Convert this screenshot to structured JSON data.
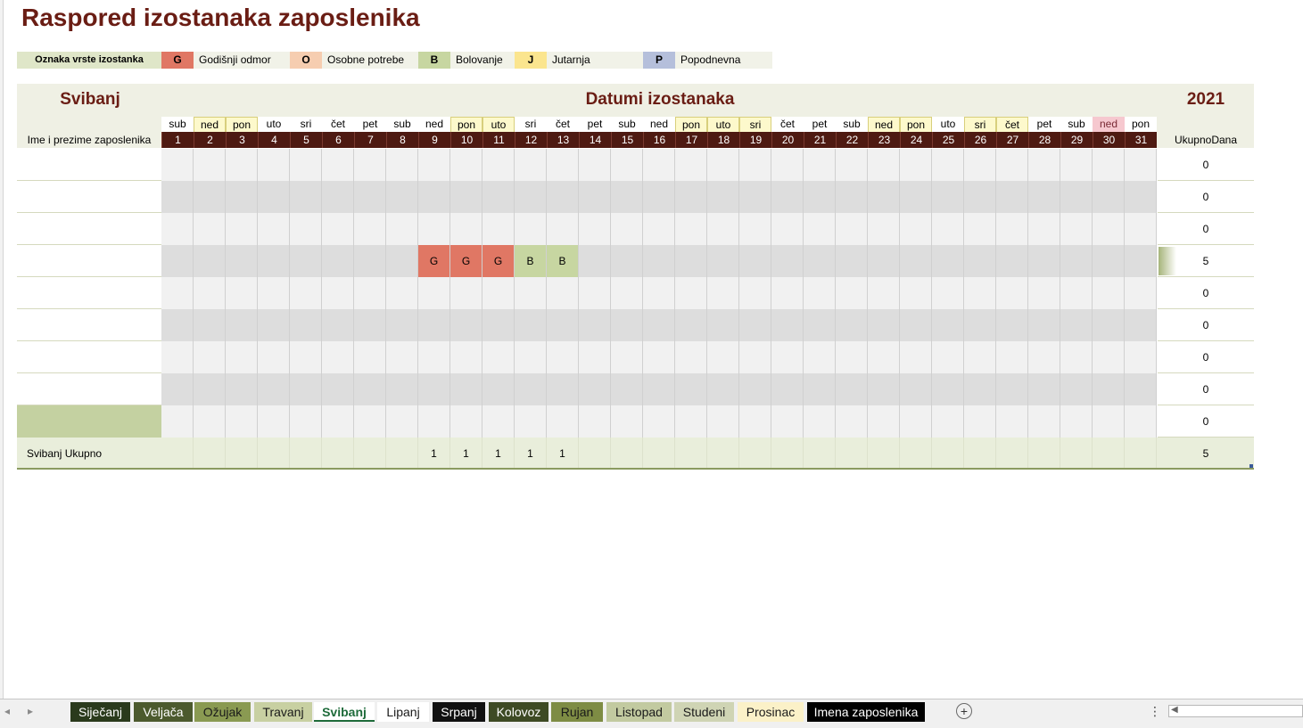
{
  "title": "Raspored izostanaka zaposlenika",
  "legend": {
    "header": "Oznaka vrste izostanka",
    "items": [
      {
        "code": "G",
        "label": "Godišnji odmor",
        "color": "#e07764"
      },
      {
        "code": "O",
        "label": "Osobne potrebe",
        "color": "#f6cdb0"
      },
      {
        "code": "B",
        "label": "Bolovanje",
        "color": "#c7d6a1"
      },
      {
        "code": "J",
        "label": "Jutarnja",
        "color": "#fbe58e"
      },
      {
        "code": "P",
        "label": "Popodnevna",
        "color": "#b5bfdb"
      }
    ]
  },
  "header": {
    "month": "Svibanj",
    "dates_title": "Datumi izostanaka",
    "year": "2021",
    "name_col": "Ime i prezime zaposlenika",
    "total_col": "UkupnoDana"
  },
  "days": [
    {
      "num": "1",
      "dow": "sub",
      "hl": false,
      "hol": false
    },
    {
      "num": "2",
      "dow": "ned",
      "hl": true,
      "hol": false
    },
    {
      "num": "3",
      "dow": "pon",
      "hl": true,
      "hol": false
    },
    {
      "num": "4",
      "dow": "uto",
      "hl": false,
      "hol": false
    },
    {
      "num": "5",
      "dow": "sri",
      "hl": false,
      "hol": false
    },
    {
      "num": "6",
      "dow": "čet",
      "hl": false,
      "hol": false
    },
    {
      "num": "7",
      "dow": "pet",
      "hl": false,
      "hol": false
    },
    {
      "num": "8",
      "dow": "sub",
      "hl": false,
      "hol": false
    },
    {
      "num": "9",
      "dow": "ned",
      "hl": false,
      "hol": false
    },
    {
      "num": "10",
      "dow": "pon",
      "hl": true,
      "hol": false
    },
    {
      "num": "11",
      "dow": "uto",
      "hl": true,
      "hol": false
    },
    {
      "num": "12",
      "dow": "sri",
      "hl": false,
      "hol": false
    },
    {
      "num": "13",
      "dow": "čet",
      "hl": false,
      "hol": false
    },
    {
      "num": "14",
      "dow": "pet",
      "hl": false,
      "hol": false
    },
    {
      "num": "15",
      "dow": "sub",
      "hl": false,
      "hol": false
    },
    {
      "num": "16",
      "dow": "ned",
      "hl": false,
      "hol": false
    },
    {
      "num": "17",
      "dow": "pon",
      "hl": true,
      "hol": false
    },
    {
      "num": "18",
      "dow": "uto",
      "hl": true,
      "hol": false
    },
    {
      "num": "19",
      "dow": "sri",
      "hl": true,
      "hol": false
    },
    {
      "num": "20",
      "dow": "čet",
      "hl": false,
      "hol": false
    },
    {
      "num": "21",
      "dow": "pet",
      "hl": false,
      "hol": false
    },
    {
      "num": "22",
      "dow": "sub",
      "hl": false,
      "hol": false
    },
    {
      "num": "23",
      "dow": "ned",
      "hl": true,
      "hol": false
    },
    {
      "num": "24",
      "dow": "pon",
      "hl": true,
      "hol": false
    },
    {
      "num": "25",
      "dow": "uto",
      "hl": false,
      "hol": false
    },
    {
      "num": "26",
      "dow": "sri",
      "hl": true,
      "hol": false
    },
    {
      "num": "27",
      "dow": "čet",
      "hl": true,
      "hol": false
    },
    {
      "num": "28",
      "dow": "pet",
      "hl": false,
      "hol": false
    },
    {
      "num": "29",
      "dow": "sub",
      "hl": false,
      "hol": false
    },
    {
      "num": "30",
      "dow": "ned",
      "hl": false,
      "hol": true
    },
    {
      "num": "31",
      "dow": "pon",
      "hl": false,
      "hol": false
    }
  ],
  "rows": [
    {
      "name": "",
      "total": "0",
      "cells": {}
    },
    {
      "name": "",
      "total": "0",
      "cells": {}
    },
    {
      "name": "",
      "total": "0",
      "cells": {}
    },
    {
      "name": "",
      "total": "5",
      "cells": {
        "9": "G",
        "10": "G",
        "11": "G",
        "12": "B",
        "13": "B"
      }
    },
    {
      "name": "",
      "total": "0",
      "cells": {}
    },
    {
      "name": "",
      "total": "0",
      "cells": {}
    },
    {
      "name": "",
      "total": "0",
      "cells": {}
    },
    {
      "name": "",
      "total": "0",
      "cells": {}
    },
    {
      "name": "",
      "total": "0",
      "cells": {}
    }
  ],
  "summary": {
    "label": "Svibanj Ukupno",
    "values": {
      "9": "1",
      "10": "1",
      "11": "1",
      "12": "1",
      "13": "1"
    },
    "total": "5"
  },
  "sheet_tabs": [
    {
      "label": "Siječanj",
      "bg": "#2a3a1c",
      "fg": "#ffffff"
    },
    {
      "label": "Veljača",
      "bg": "#4c5a2e",
      "fg": "#ffffff"
    },
    {
      "label": "Ožujak",
      "bg": "#8a9a52",
      "fg": "#1a1a1a"
    },
    {
      "label": "Travanj",
      "bg": "#c8d0a2",
      "fg": "#1a1a1a"
    },
    {
      "label": "Svibanj",
      "bg": "#ffffff",
      "fg": "#1e6b3a",
      "active": true
    },
    {
      "label": "Lipanj",
      "bg": "#ffffff",
      "fg": "#1a1a1a"
    },
    {
      "label": "Srpanj",
      "bg": "#111111",
      "fg": "#ffffff"
    },
    {
      "label": "Kolovoz",
      "bg": "#3e4a24",
      "fg": "#ffffff"
    },
    {
      "label": "Rujan",
      "bg": "#7e8c44",
      "fg": "#1a1a1a"
    },
    {
      "label": "Listopad",
      "bg": "#c2caa0",
      "fg": "#1a1a1a"
    },
    {
      "label": "Studeni",
      "bg": "#cfd4b4",
      "fg": "#1a1a1a"
    },
    {
      "label": "Prosinac",
      "bg": "#fbf1c8",
      "fg": "#1a1a1a"
    },
    {
      "label": "Imena zaposlenika",
      "bg": "#000000",
      "fg": "#ffffff"
    }
  ],
  "colors": {
    "title": "#6a1d14",
    "day_header_bg": "#4e1a12",
    "row_light": "#f1f1f1",
    "row_dark": "#dddddd",
    "summary_bg": "#e9eedb"
  }
}
